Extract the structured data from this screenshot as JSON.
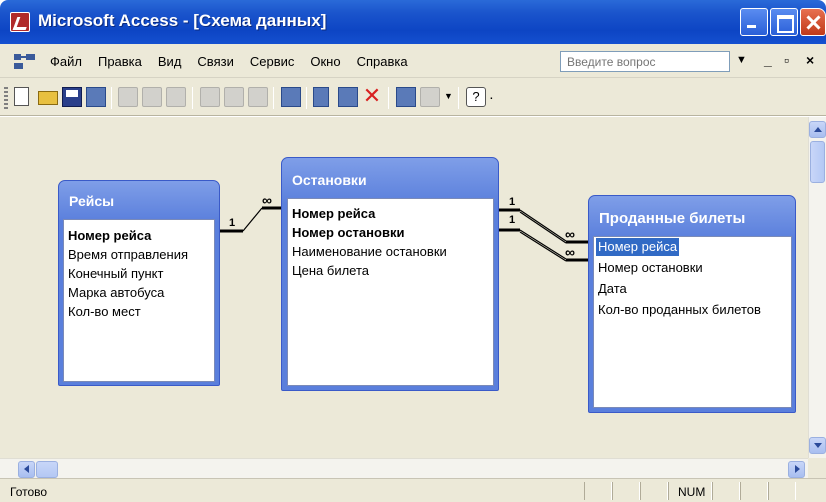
{
  "window": {
    "title": "Microsoft Access - [Схема данных]",
    "title_bar_color": "#0d45c4"
  },
  "menu": {
    "items": [
      "Файл",
      "Правка",
      "Вид",
      "Связи",
      "Сервис",
      "Окно",
      "Справка"
    ],
    "help_placeholder": "Введите вопрос"
  },
  "toolbar": {
    "icons": [
      "new-icon",
      "open-icon",
      "save-icon",
      "relationships-icon",
      "print-icon",
      "print-preview-icon",
      "spelling-icon",
      "cut-icon",
      "copy-icon",
      "paste-icon",
      "show-table-icon",
      "show-direct-icon",
      "show-all-icon",
      "delete-icon",
      "database-window-icon",
      "new-object-icon",
      "help-icon"
    ]
  },
  "tables": {
    "reisy": {
      "title": "Рейсы",
      "fields": [
        "Номер рейса",
        "Время отправления",
        "Конечный пункт",
        "Марка автобуса",
        "Кол-во мест"
      ]
    },
    "ostanovki": {
      "title": "Остановки",
      "fields": [
        "Номер рейса",
        "Номер остановки",
        "Наименование остановки",
        "Цена билета"
      ]
    },
    "prodannye": {
      "title": "Проданные билеты",
      "fields": [
        "Номер рейса",
        "Номер остановки",
        "Дата",
        "Кол-во проданных билетов"
      ]
    }
  },
  "relations": {
    "one_label": "1",
    "many_label": "∞"
  },
  "status": {
    "text": "Готово",
    "num": "NUM"
  }
}
